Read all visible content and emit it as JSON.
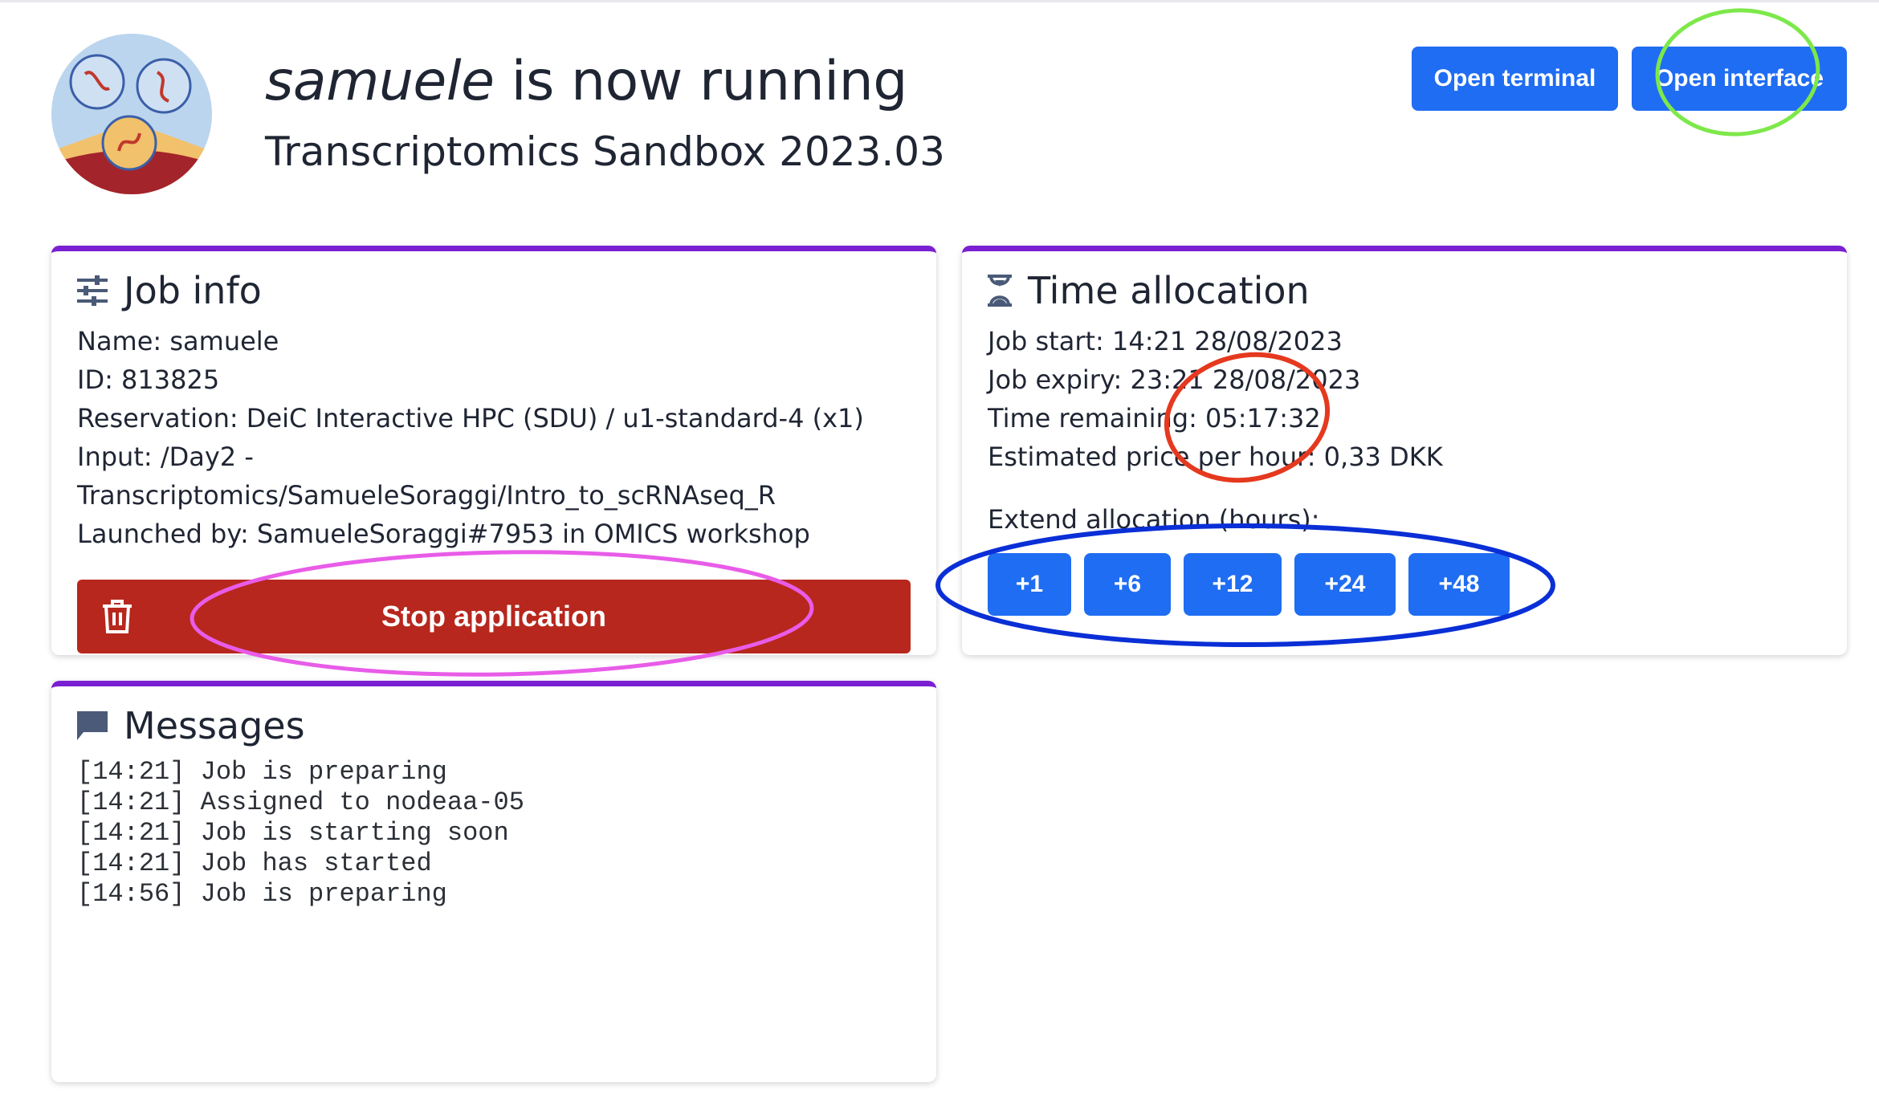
{
  "header": {
    "job_name": "samuele",
    "running_text": " is now running",
    "subtitle": "Transcriptomics Sandbox 2023.03",
    "buttons": {
      "terminal": "Open terminal",
      "interface": "Open interface"
    }
  },
  "job_info": {
    "title": "Job info",
    "lines": [
      "Name: samuele",
      "ID: 813825",
      "Reservation: DeiC Interactive HPC (SDU) / u1-standard-4 (x1)",
      "Input: /Day2 -",
      "Transcriptomics/SamueleSoraggi/Intro_to_scRNAseq_R",
      "Launched by: SamueleSoraggi#7953 in OMICS workshop"
    ],
    "stop_label": "Stop application"
  },
  "time_allocation": {
    "title": "Time allocation",
    "lines": [
      "Job start: 14:21 28/08/2023",
      "Job expiry: 23:21 28/08/2023",
      "Time remaining: 05:17:32",
      "Estimated price per hour: 0,33 DKK"
    ],
    "extend_label": "Extend allocation (hours):",
    "extend_buttons": [
      "+1",
      "+6",
      "+12",
      "+24",
      "+48"
    ]
  },
  "messages": {
    "title": "Messages",
    "lines": [
      "[14:21] Job is preparing",
      "[14:21] Assigned to nodeaa-05",
      "[14:21] Job is starting soon",
      "[14:21] Job has started",
      "[14:56] Job is preparing"
    ]
  },
  "colors": {
    "primary": "#1f6df2",
    "danger": "#b7271d",
    "card_accent": "#7a1fd1",
    "annotation_green": "#7de84a",
    "annotation_red": "#e5391f",
    "annotation_pink": "#e85ce8",
    "annotation_blue": "#0a2fd6"
  }
}
